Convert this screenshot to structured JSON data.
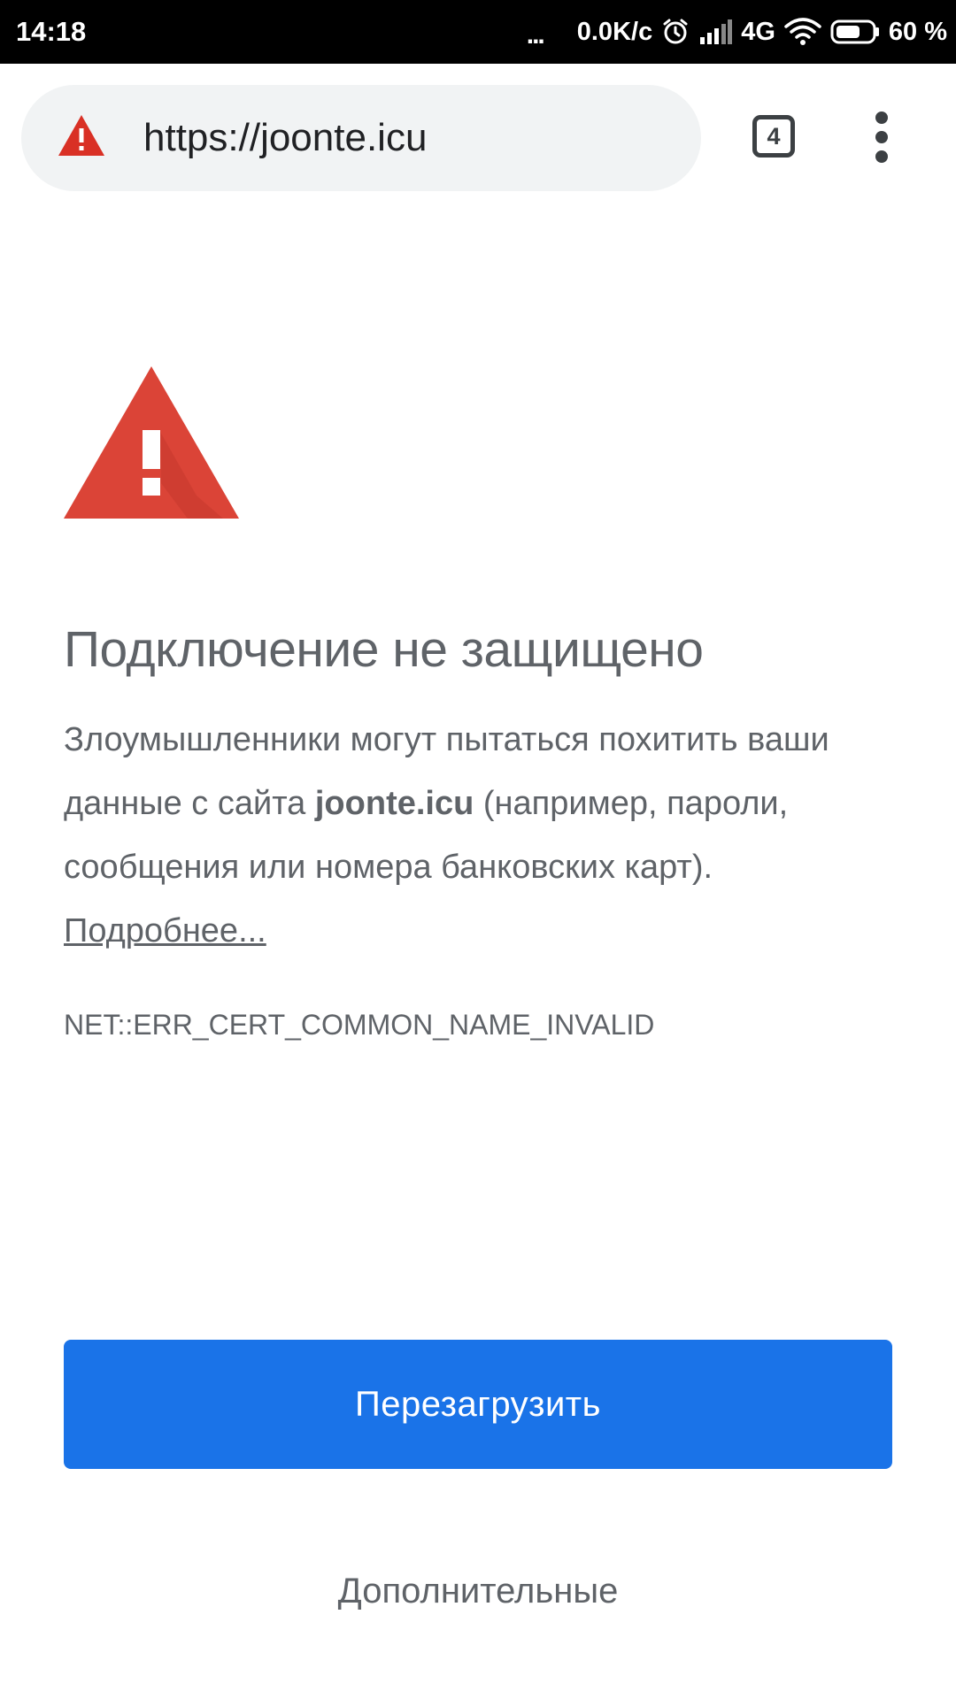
{
  "status_bar": {
    "time": "14:18",
    "more_indicator": "...",
    "network_speed": "0.0K/c",
    "network_type": "4G",
    "battery_percent": "60 %",
    "icons": [
      "alarm-icon",
      "cellular-signal-icon",
      "wifi-icon",
      "battery-icon"
    ]
  },
  "toolbar": {
    "url": "https://joonte.icu",
    "tab_count": "4",
    "security_icon": "not-secure-warning-icon",
    "menu_icon": "more-vert-icon"
  },
  "interstitial": {
    "icon": "warning-triangle-icon",
    "heading": "Подключение не защищено",
    "explanation_part1": "Злоумышленники могут пытаться похитить ваши данные с сайта ",
    "domain": "joonte.icu",
    "explanation_part2": " (например, пароли, сообщения или номера банковских карт).",
    "learn_more": "Подробнее...",
    "error_code": "NET::ERR_CERT_COMMON_NAME_INVALID"
  },
  "buttons": {
    "reload": "Перезагрузить",
    "details": "Дополнительные"
  },
  "colors": {
    "warning_red": "#d93025",
    "primary_blue": "#1a73e8",
    "text_gray": "#5f6368",
    "url_bar_bg": "#f1f3f4"
  }
}
